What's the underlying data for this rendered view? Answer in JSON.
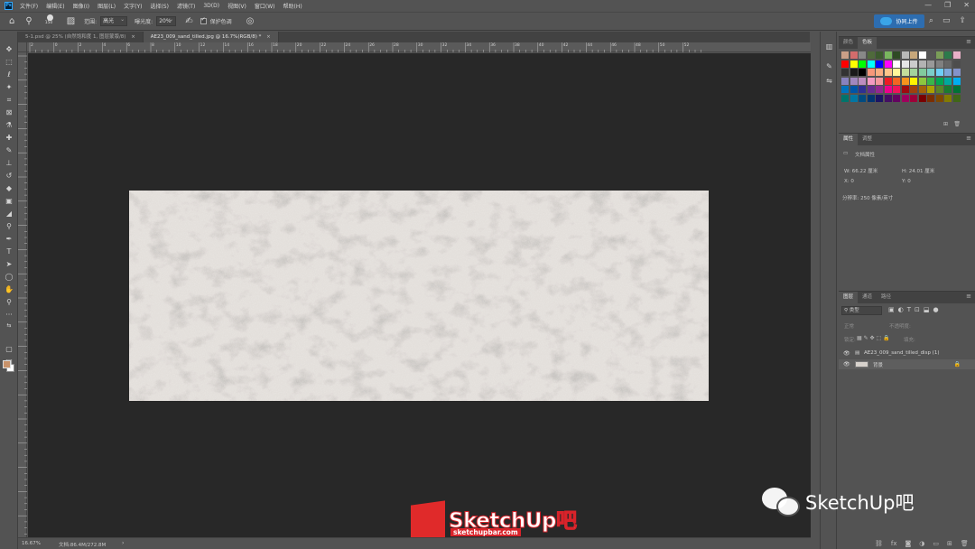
{
  "app": {
    "logo_text": "Ps"
  },
  "menu": [
    "文件(F)",
    "编辑(E)",
    "图像(I)",
    "图层(L)",
    "文字(Y)",
    "选择(S)",
    "滤镜(T)",
    "3D(D)",
    "视图(V)",
    "窗口(W)",
    "帮助(H)"
  ],
  "options": {
    "brush_size": "150",
    "range_label": "范围:",
    "range_value": "高光",
    "exposure_label": "曝光度:",
    "exposure_value": "20%",
    "protect_tone_label": "保护色调",
    "share_label": "协同上传"
  },
  "tabs": [
    {
      "label": "5-1.psd @ 25% (自然饱和度 1, 图层蒙版/8)",
      "active": false
    },
    {
      "label": "AE23_009_sand_tilled.jpg @ 16.7%(RGB/8) *",
      "active": true
    }
  ],
  "ruler_ticks": [
    "2",
    "0",
    "2",
    "4",
    "6",
    "8",
    "10",
    "12",
    "14",
    "16",
    "18",
    "20",
    "22",
    "24",
    "26",
    "28",
    "30",
    "32",
    "34",
    "36",
    "38",
    "40",
    "42",
    "44",
    "46",
    "48",
    "50",
    "52"
  ],
  "status": {
    "zoom": "16.67%",
    "doc": "文档:86.4M/272.8M"
  },
  "swatches_panel": {
    "tabs": [
      "颜色",
      "色板"
    ],
    "active": 1
  },
  "swatch_colors": [
    "#c99f87",
    "#d36c6c",
    "#888888",
    "#4f6a3b",
    "#3c5a2e",
    "#79b65e",
    "#2e4a24",
    "#b9b9b9",
    "#c7a77a",
    "#ffffff",
    "#555555",
    "#7a9e58",
    "#2c7a4b",
    "#e8b0c8",
    "#ff0000",
    "#ffff00",
    "#00ff00",
    "#00ffff",
    "#0000ff",
    "#ff00ff",
    "#ffffff",
    "#e6e6e6",
    "#cccccc",
    "#b3b3b3",
    "#999999",
    "#808080",
    "#666666",
    "#4d4d4d",
    "#333333",
    "#1a1a1a",
    "#000000",
    "#f7977a",
    "#f9ad81",
    "#fdc68a",
    "#fff79a",
    "#c4df9b",
    "#a3d39c",
    "#82ca9d",
    "#7bcdc8",
    "#6ecff6",
    "#7ea7d8",
    "#8493ca",
    "#8882be",
    "#a187be",
    "#bc8dbf",
    "#f49ac2",
    "#f6989d",
    "#ed1c24",
    "#f26522",
    "#f7941d",
    "#fff200",
    "#8dc73f",
    "#39b54a",
    "#00a651",
    "#00a99d",
    "#00aeef",
    "#0072bc",
    "#0054a6",
    "#2e3192",
    "#662d91",
    "#92278f",
    "#ec008c",
    "#ed145b",
    "#9e0b0f",
    "#a0410d",
    "#a36209",
    "#aba000",
    "#598527",
    "#1a7b30",
    "#007236",
    "#00746b",
    "#0076a3",
    "#004b80",
    "#003471",
    "#1b1464",
    "#440e62",
    "#630460",
    "#9e005d",
    "#9e0039",
    "#790000",
    "#7b2e00",
    "#7d4900",
    "#827b00",
    "#406618"
  ],
  "properties": {
    "tabs": [
      "属性",
      "调整"
    ],
    "doc_label": "文档属性",
    "w": "W:  66.22 厘米",
    "h": "H:  24.01 厘米",
    "x": "X:  0",
    "y": "Y:  0",
    "resolution": "分辨率: 250 像素/英寸"
  },
  "layers": {
    "tabs": [
      "图层",
      "通道",
      "路径"
    ],
    "filter": "类型",
    "mode": "正常",
    "opacity": "不透明度:",
    "lock": "锁定:",
    "fill": "填充:",
    "rows": [
      {
        "name": "AE23_009_sand_tilled_disp (1)",
        "selected": false
      },
      {
        "name": "背景",
        "selected": true
      }
    ]
  },
  "watermarks": {
    "wechat_text": "SketchUp吧",
    "brand_text": "SketchUp吧",
    "brand_url": "sketchupbar.com"
  }
}
